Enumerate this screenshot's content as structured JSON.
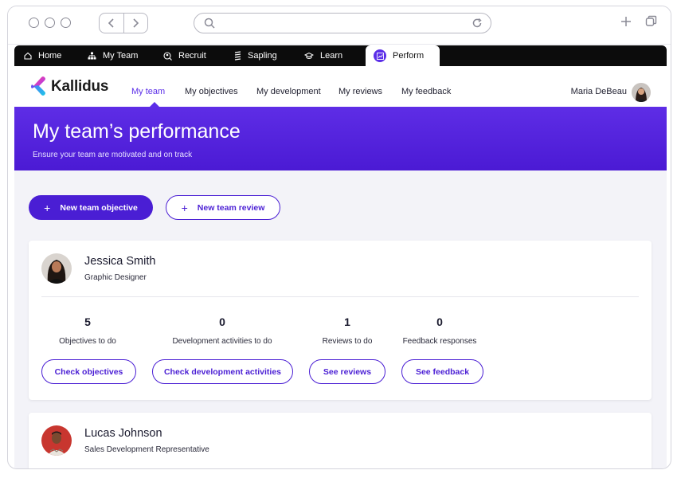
{
  "tabs": [
    {
      "label": "Home",
      "icon": "home-icon"
    },
    {
      "label": "My Team",
      "icon": "org-chart-icon"
    },
    {
      "label": "Recruit",
      "icon": "recruit-icon"
    },
    {
      "label": "Sapling",
      "icon": "sapling-icon"
    },
    {
      "label": "Learn",
      "icon": "learn-icon"
    },
    {
      "label": "Perform",
      "icon": "perform-icon",
      "active": true
    }
  ],
  "brand": {
    "name": "Kallidus",
    "accent": "#5b2ee8"
  },
  "nav": {
    "items": [
      "My team",
      "My objectives",
      "My development",
      "My reviews",
      "My feedback"
    ],
    "active": "My team"
  },
  "user": {
    "name": "Maria DeBeau"
  },
  "hero": {
    "title": "My team’s performance",
    "subtitle": "Ensure your team are motivated and on track"
  },
  "actions": {
    "new_objective": "New team objective",
    "new_review": "New team review"
  },
  "members": [
    {
      "name": "Jessica Smith",
      "role": "Graphic Designer",
      "stats": [
        {
          "value": "5",
          "label": "Objectives to do"
        },
        {
          "value": "0",
          "label": "Development activities to do"
        },
        {
          "value": "1",
          "label": "Reviews to do"
        },
        {
          "value": "0",
          "label": "Feedback responses"
        }
      ],
      "buttons": [
        "Check objectives",
        "Check development activities",
        "See reviews",
        "See feedback"
      ]
    },
    {
      "name": "Lucas Johnson",
      "role": "Sales Development Representative"
    }
  ]
}
